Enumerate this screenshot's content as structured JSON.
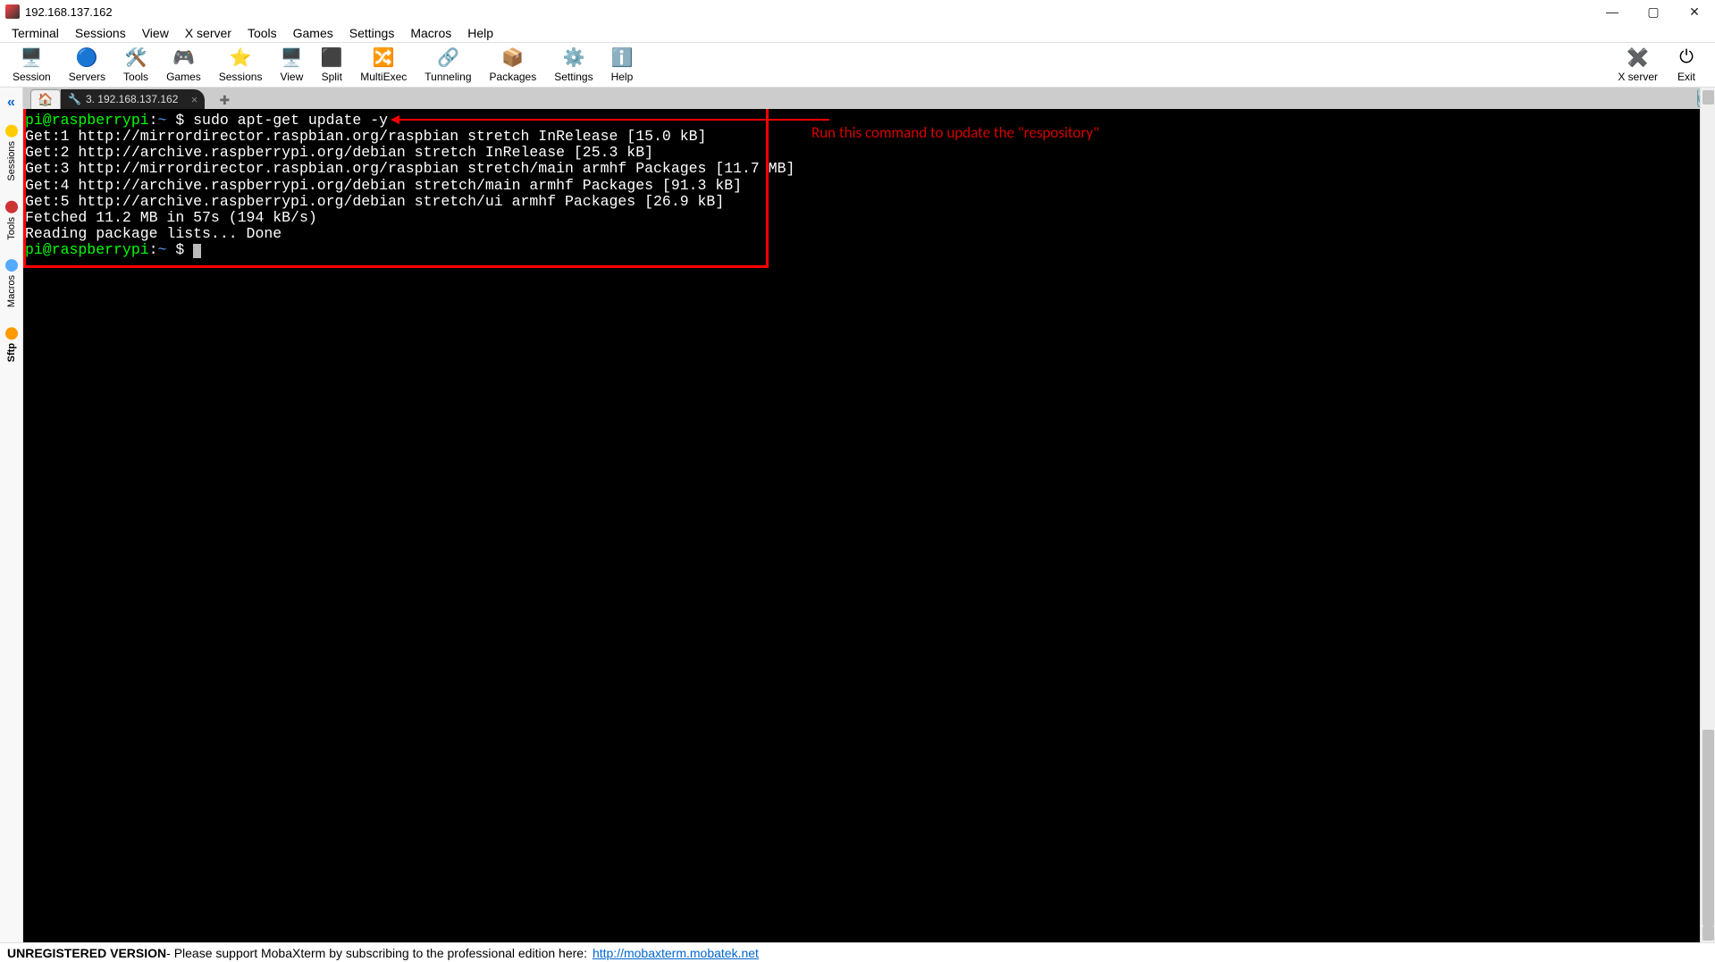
{
  "window": {
    "title": "192.168.137.162"
  },
  "menu": [
    "Terminal",
    "Sessions",
    "View",
    "X server",
    "Tools",
    "Games",
    "Settings",
    "Macros",
    "Help"
  ],
  "tools": {
    "left": [
      {
        "label": "Session",
        "icon": "🖥️",
        "name": "session-button"
      },
      {
        "label": "Servers",
        "icon": "🔵",
        "name": "servers-button"
      },
      {
        "label": "Tools",
        "icon": "🛠️",
        "name": "tools-button"
      },
      {
        "label": "Games",
        "icon": "🎮",
        "name": "games-button"
      },
      {
        "label": "Sessions",
        "icon": "⭐",
        "name": "sessions-button"
      },
      {
        "label": "View",
        "icon": "🖥️",
        "name": "view-button"
      },
      {
        "label": "Split",
        "icon": "⬛",
        "name": "split-button"
      },
      {
        "label": "MultiExec",
        "icon": "🔀",
        "name": "multiexec-button"
      },
      {
        "label": "Tunneling",
        "icon": "🔗",
        "name": "tunneling-button"
      },
      {
        "label": "Packages",
        "icon": "📦",
        "name": "packages-button"
      },
      {
        "label": "Settings",
        "icon": "⚙️",
        "name": "settings-button"
      },
      {
        "label": "Help",
        "icon": "ℹ️",
        "name": "help-button"
      }
    ],
    "right": [
      {
        "label": "X server",
        "icon": "✖️",
        "name": "xserver-button"
      },
      {
        "label": "Exit",
        "icon": "⏻",
        "name": "exit-button"
      }
    ]
  },
  "side_tabs": [
    "Sessions",
    "Tools",
    "Macros",
    "Sftp"
  ],
  "tabs": {
    "home_icon": "🏠",
    "session_label": "3. 192.168.137.162",
    "new_icon": "✚"
  },
  "terminal": {
    "prompt_user": "pi@raspberrypi",
    "prompt_sep": ":",
    "prompt_path": "~",
    "prompt_symbol": "$",
    "cmd": "sudo apt-get update -y",
    "lines": [
      "Get:1 http://mirrordirector.raspbian.org/raspbian stretch InRelease [15.0 kB]",
      "Get:2 http://archive.raspberrypi.org/debian stretch InRelease [25.3 kB]",
      "Get:3 http://mirrordirector.raspbian.org/raspbian stretch/main armhf Packages [11.7 MB]",
      "Get:4 http://archive.raspberrypi.org/debian stretch/main armhf Packages [91.3 kB]",
      "Get:5 http://archive.raspberrypi.org/debian stretch/ui armhf Packages [26.9 kB]",
      "Fetched 11.2 MB in 57s (194 kB/s)",
      "Reading package lists... Done"
    ]
  },
  "annotation": {
    "text": "Run this command to update the \"respository\""
  },
  "status": {
    "unreg": "UNREGISTERED VERSION",
    "msg": "  -   Please support MobaXterm by subscribing to the professional edition here:",
    "link": "http://mobaxterm.mobatek.net"
  }
}
